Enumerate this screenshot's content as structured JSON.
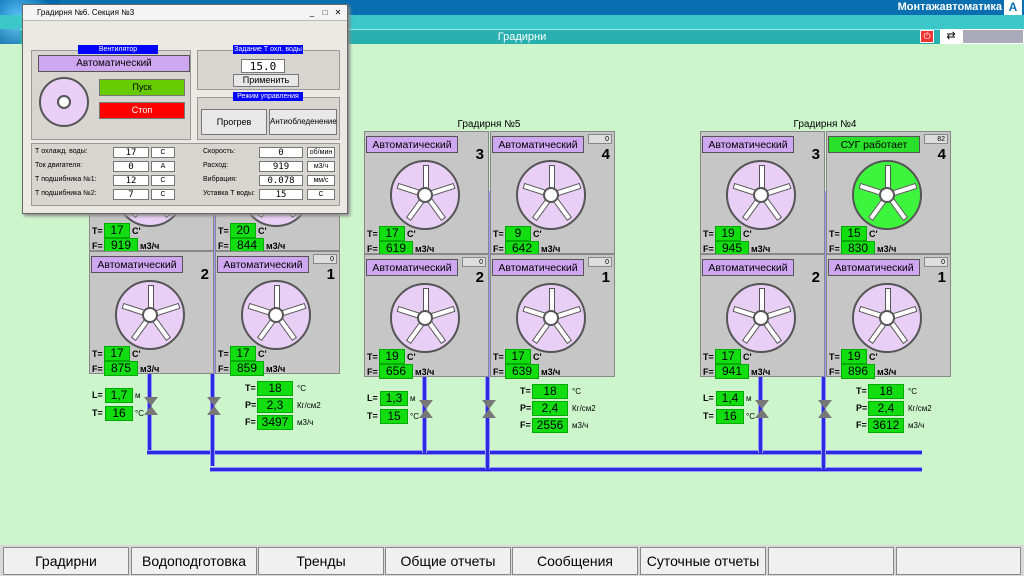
{
  "header": {
    "brand": "Монтажавтоматика",
    "screen_title": "Градирни"
  },
  "dialog": {
    "title": "Градирня №6. Секция №3",
    "fan_group": "Вентилятор",
    "mode": "Автоматический",
    "start_label": "Пуск",
    "stop_label": "Стоп",
    "setpoint_group": "Задание Т охл. воды",
    "setpoint_value": "15.0",
    "apply_label": "Применить",
    "control_group": "Режим управления",
    "heat_label": "Прогрев",
    "anti_ice_label": "Антиобледенение",
    "params_left": [
      {
        "label": "Т охлажд. воды:",
        "value": "17",
        "unit": "C"
      },
      {
        "label": "Ток двигателя:",
        "value": "0",
        "unit": "A"
      },
      {
        "label": "Т подшибника №1:",
        "value": "12",
        "unit": "C"
      },
      {
        "label": "Т подшибника №2:",
        "value": "7",
        "unit": "C"
      }
    ],
    "params_right": [
      {
        "label": "Скорость:",
        "value": "0",
        "unit": "об/мин"
      },
      {
        "label": "Расход:",
        "value": "919",
        "unit": "м3/ч"
      },
      {
        "label": "Вибрация:",
        "value": "0.078",
        "unit": "мм/с"
      },
      {
        "label": "Уставка Т воды:",
        "value": "15",
        "unit": "C"
      }
    ]
  },
  "towers": [
    {
      "title": "",
      "cells": [
        {
          "mode": "",
          "num": "",
          "zero": "",
          "T": "17",
          "F": "919"
        },
        {
          "mode": "",
          "num": "",
          "zero": "",
          "T": "20",
          "F": "844"
        },
        {
          "mode": "Автоматический",
          "num": "2",
          "zero": "",
          "T": "17",
          "F": "875"
        },
        {
          "mode": "Автоматический",
          "num": "1",
          "zero": "0",
          "T": "17",
          "F": "859"
        }
      ],
      "L": "1,7",
      "Tin": "16",
      "To": "18",
      "P": "2,3",
      "Ft": "3497"
    },
    {
      "title": "Градирня №5",
      "cells": [
        {
          "mode": "Автоматический",
          "num": "3",
          "zero": "",
          "T": "17",
          "F": "619"
        },
        {
          "mode": "Автоматический",
          "num": "4",
          "zero": "0",
          "T": "9",
          "F": "642"
        },
        {
          "mode": "Автоматический",
          "num": "2",
          "zero": "0",
          "T": "19",
          "F": "656"
        },
        {
          "mode": "Автоматический",
          "num": "1",
          "zero": "0",
          "T": "17",
          "F": "639"
        }
      ],
      "L": "1,3",
      "Tin": "15",
      "To": "18",
      "P": "2,4",
      "Ft": "2556"
    },
    {
      "title": "Градирня №4",
      "cells": [
        {
          "mode": "Автоматический",
          "num": "3",
          "zero": "",
          "T": "19",
          "F": "945"
        },
        {
          "mode": "СУГ работает",
          "num": "4",
          "zero": "82",
          "T": "15",
          "F": "830",
          "green": true
        },
        {
          "mode": "Автоматический",
          "num": "2",
          "zero": "",
          "T": "17",
          "F": "941"
        },
        {
          "mode": "Автоматический",
          "num": "1",
          "zero": "0",
          "T": "19",
          "F": "896"
        }
      ],
      "L": "1,4",
      "Tin": "16",
      "To": "18",
      "P": "2,4",
      "Ft": "3612"
    }
  ],
  "units": {
    "temp": "C'",
    "flow": "м3/ч",
    "m": "м",
    "deg": "°C",
    "pres": "Кг/см2",
    "mh": "м3/ч"
  },
  "labels": {
    "T": "T=",
    "F": "F=",
    "L": "L=",
    "P": "P="
  },
  "nav": [
    "Градирни",
    "Водоподготовка",
    "Тренды",
    "Общие отчеты",
    "Сообщения",
    "Суточные отчеты",
    "",
    ""
  ]
}
